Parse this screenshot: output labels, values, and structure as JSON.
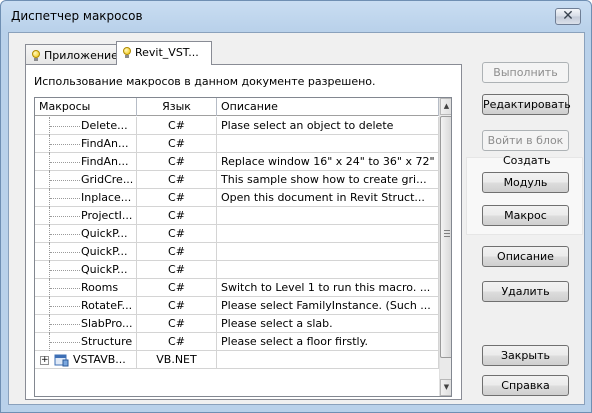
{
  "window": {
    "title": "Диспетчер макросов",
    "close_glyph": "✕"
  },
  "tabs": [
    {
      "label": "Приложение",
      "icon": "bulb-icon",
      "active": false
    },
    {
      "label": "Revit_VST...",
      "icon": "bulb-icon",
      "active": true
    }
  ],
  "panel": {
    "info": "Использование макросов в данном документе разрешено."
  },
  "grid": {
    "columns": {
      "macros": "Макросы",
      "lang": "Язык",
      "desc": "Описание"
    },
    "rows": [
      {
        "name": "Delete...",
        "lang": "C#",
        "desc": "Plase select an object to delete"
      },
      {
        "name": "FindAn...",
        "lang": "C#",
        "desc": ""
      },
      {
        "name": "FindAn...",
        "lang": "C#",
        "desc": "Replace window 16\" x 24\" to 36\" x 72\""
      },
      {
        "name": "GridCre...",
        "lang": "C#",
        "desc": "This sample show how to create gri..."
      },
      {
        "name": "Inplace...",
        "lang": "C#",
        "desc": "Open this document in Revit Struct..."
      },
      {
        "name": "ProjectI...",
        "lang": "C#",
        "desc": ""
      },
      {
        "name": "QuickP...",
        "lang": "C#",
        "desc": ""
      },
      {
        "name": "QuickP...",
        "lang": "C#",
        "desc": ""
      },
      {
        "name": "QuickP...",
        "lang": "C#",
        "desc": ""
      },
      {
        "name": "Rooms",
        "lang": "C#",
        "desc": "Switch to Level 1 to run this macro. ..."
      },
      {
        "name": "RotateF...",
        "lang": "C#",
        "desc": "Please select FamilyInstance. (Such ..."
      },
      {
        "name": "SlabPro...",
        "lang": "C#",
        "desc": "Please select a slab."
      },
      {
        "name": "Structure",
        "lang": "C#",
        "desc": "Please select a floor firstly."
      }
    ],
    "project_row": {
      "name": "VSTAVB...",
      "lang": "VB.NET",
      "desc": "",
      "expander": "+"
    }
  },
  "buttons": {
    "run": "Выполнить",
    "edit": "Редактировать",
    "step_into": "Войти в блок",
    "create_group": "Создать",
    "module": "Модуль",
    "macro": "Макрос",
    "description": "Описание",
    "delete": "Удалить",
    "close": "Закрыть",
    "help": "Справка"
  }
}
